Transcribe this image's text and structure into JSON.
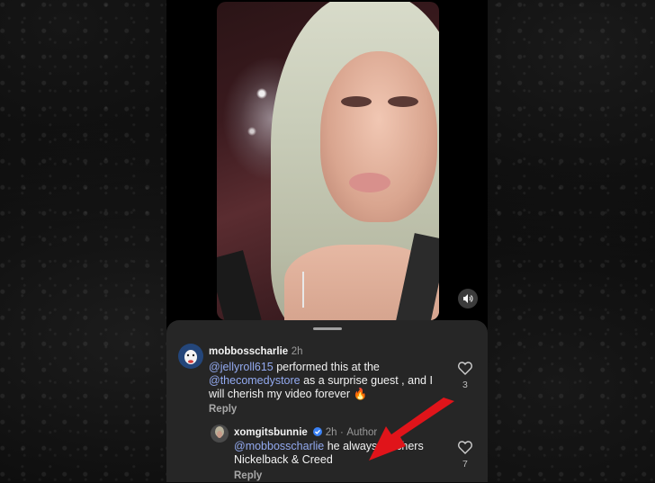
{
  "comments": [
    {
      "username": "mobbosscharlie",
      "time": "2h",
      "mention1": "@jellyroll615",
      "text1": " performed this at the",
      "mention2": "@thecomedystore",
      "text2": " as a surprise guest , and I",
      "text3": "will cherish my video forever 🔥",
      "reply_label": "Reply",
      "like_count": "3"
    },
    {
      "username": "xomgitsbunnie",
      "time": "2h",
      "author_tag": "Author",
      "mention": "@mobbosscharlie",
      "text1": " he always butchers",
      "text2": "Nickelback & Creed",
      "reply_label": "Reply",
      "like_count": "7"
    }
  ],
  "colors": {
    "mention": "#93aaf0",
    "arrow": "#e0141a",
    "sheet": "#262626"
  },
  "icons": [
    "speaker-icon",
    "heart-icon",
    "verified-badge-icon",
    "arrow-annotation"
  ]
}
